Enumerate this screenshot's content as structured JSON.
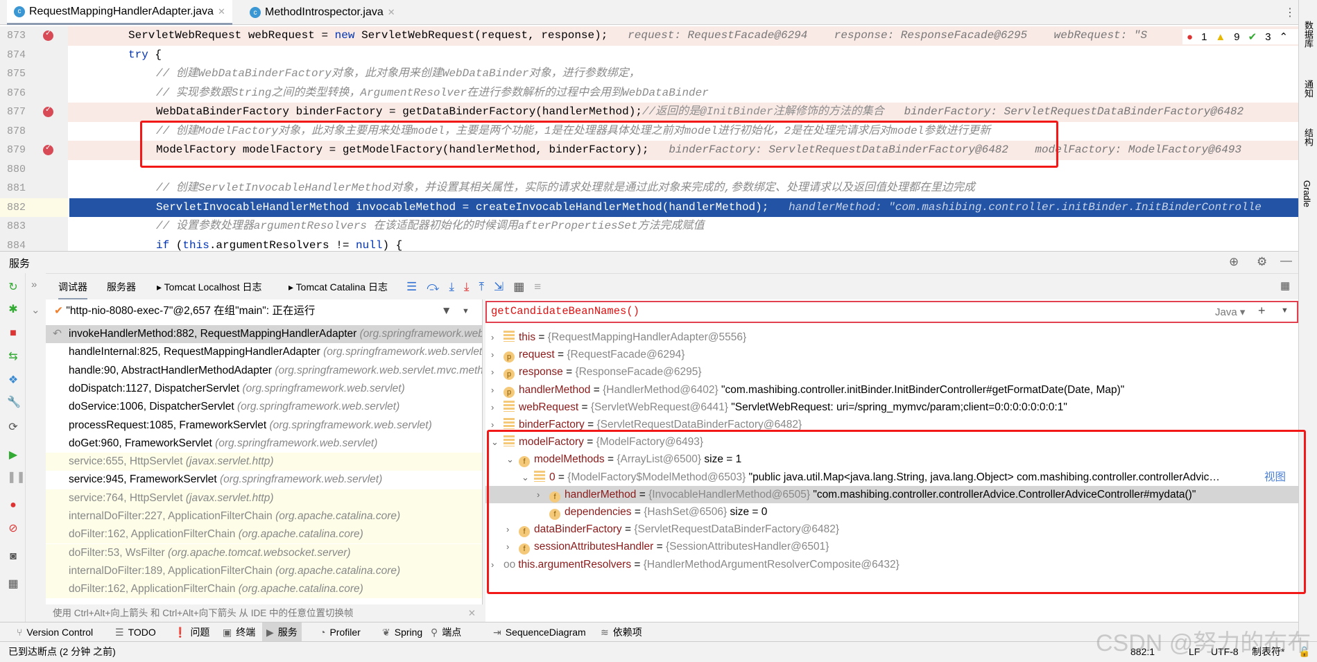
{
  "tabs": [
    {
      "label": "RequestMappingHandlerAdapter.java",
      "active": true
    },
    {
      "label": "MethodIntrospector.java",
      "active": false
    }
  ],
  "inspections": {
    "errors": "1",
    "warnings": "9",
    "ok": "3"
  },
  "editor": {
    "lines": [
      {
        "n": "873",
        "bp": true,
        "pink": true,
        "parts": [
          {
            "c": "ServletWebRequest webRequest = ",
            "k": ""
          },
          {
            "c": "new",
            "k": "kw"
          },
          {
            "c": " ServletWebRequest(request, response);",
            "k": ""
          }
        ],
        "inline": "request: RequestFacade@6294    response: ResponseFacade@6295    webRequest: \"S"
      },
      {
        "n": "874",
        "parts": [
          {
            "c": "try",
            "k": "kw"
          },
          {
            "c": " {",
            "k": ""
          }
        ],
        "indent": 0
      },
      {
        "n": "875",
        "parts": [
          {
            "c": "// 创建WebDataBinderFactory对象，此对象用来创建WebDataBinder对象，进行参数绑定，",
            "k": "cm"
          }
        ],
        "indent": 1
      },
      {
        "n": "876",
        "parts": [
          {
            "c": "// 实现参数跟String之间的类型转换，ArgumentResolver在进行参数解析的过程中会用到WebDataBinder",
            "k": "cm"
          }
        ],
        "indent": 1
      },
      {
        "n": "877",
        "bp": true,
        "pink": true,
        "parts": [
          {
            "c": "WebDataBinderFactory binderFactory = getDataBinderFactory(handlerMethod);",
            "k": ""
          },
          {
            "c": "//返回的是@InitBinder注解修饰的方法的集合",
            "k": "cm"
          }
        ],
        "indent": 1,
        "inline": "binderFactory: ServletRequestDataBinderFactory@6482"
      },
      {
        "n": "878",
        "parts": [
          {
            "c": "// 创建ModelFactory对象，此对象主要用来处理model，主要是两个功能，1是在处理器具体处理之前对model进行初始化，2是在处理完请求后对model参数进行更新",
            "k": "cm"
          }
        ],
        "indent": 1
      },
      {
        "n": "879",
        "bp": true,
        "pink": true,
        "parts": [
          {
            "c": "ModelFactory modelFactory = getModelFactory(handlerMethod, binderFactory);",
            "k": ""
          }
        ],
        "indent": 1,
        "inline": "binderFactory: ServletRequestDataBinderFactory@6482    modelFactory: ModelFactory@6493"
      },
      {
        "n": "880",
        "parts": []
      },
      {
        "n": "881",
        "parts": [
          {
            "c": "// 创建ServletInvocableHandlerMethod对象，并设置其相关属性，实际的请求处理就是通过此对象来完成的,参数绑定、处理请求以及返回值处理都在里边完成",
            "k": "cm"
          }
        ],
        "indent": 1
      },
      {
        "n": "882",
        "sel": true,
        "parts": [
          {
            "c": "ServletInvocableHandlerMethod invocableMethod = createInvocableHandlerMethod(handlerMethod);",
            "k": ""
          }
        ],
        "indent": 1,
        "inline": "handlerMethod: \"com.mashibing.controller.initBinder.InitBinderControlle"
      },
      {
        "n": "883",
        "parts": [
          {
            "c": "// 设置参数处理器argumentResolvers 在该适配器初始化的时候调用afterPropertiesSet方法完成赋值",
            "k": "cm"
          }
        ],
        "indent": 1
      },
      {
        "n": "884",
        "parts": [
          {
            "c": "if",
            "k": "kw"
          },
          {
            "c": " (",
            "k": ""
          },
          {
            "c": "this",
            "k": "kw"
          },
          {
            "c": ".argumentResolvers != ",
            "k": ""
          },
          {
            "c": "null",
            "k": "kw"
          },
          {
            "c": ") {",
            "k": ""
          }
        ],
        "indent": 1
      }
    ]
  },
  "right_tools": [
    "数据库",
    "通知",
    "结构",
    "Gradle"
  ],
  "services": {
    "title": "服务"
  },
  "debug_tabs": [
    "调试器",
    "服务器",
    "Tomcat Localhost 日志",
    "Tomcat Catalina 日志"
  ],
  "thread": "\"http-nio-8080-exec-7\"@2,657 在组\"main\": 正在运行",
  "frames": [
    {
      "m": "invokeHandlerMethod:882, RequestMappingHandlerAdapter",
      "p": "(org.springframework.web.servlet.mvc.method.annotation)",
      "t": "cur"
    },
    {
      "m": "handleInternal:825, RequestMappingHandlerAdapter",
      "p": "(org.springframework.web.servlet.mvc.method.annotation)",
      "t": ""
    },
    {
      "m": "handle:90, AbstractHandlerMethodAdapter",
      "p": "(org.springframework.web.servlet.mvc.method)",
      "t": ""
    },
    {
      "m": "doDispatch:1127, DispatcherServlet",
      "p": "(org.springframework.web.servlet)",
      "t": ""
    },
    {
      "m": "doService:1006, DispatcherServlet",
      "p": "(org.springframework.web.servlet)",
      "t": ""
    },
    {
      "m": "processRequest:1085, FrameworkServlet",
      "p": "(org.springframework.web.servlet)",
      "t": ""
    },
    {
      "m": "doGet:960, FrameworkServlet",
      "p": "(org.springframework.web.servlet)",
      "t": ""
    },
    {
      "m": "service:655, HttpServlet",
      "p": "(javax.servlet.http)",
      "t": "lib"
    },
    {
      "m": "service:945, FrameworkServlet",
      "p": "(org.springframework.web.servlet)",
      "t": ""
    },
    {
      "m": "service:764, HttpServlet",
      "p": "(javax.servlet.http)",
      "t": "lib"
    },
    {
      "m": "internalDoFilter:227, ApplicationFilterChain",
      "p": "(org.apache.catalina.core)",
      "t": "lib"
    },
    {
      "m": "doFilter:162, ApplicationFilterChain",
      "p": "(org.apache.catalina.core)",
      "t": "lib"
    },
    {
      "m": "doFilter:53, WsFilter",
      "p": "(org.apache.tomcat.websocket.server)",
      "t": "lib"
    },
    {
      "m": "internalDoFilter:189, ApplicationFilterChain",
      "p": "(org.apache.catalina.core)",
      "t": "lib"
    },
    {
      "m": "doFilter:162, ApplicationFilterChain",
      "p": "(org.apache.catalina.core)",
      "t": "lib"
    }
  ],
  "hint": "使用 Ctrl+Alt+向上箭头 和 Ctrl+Alt+向下箭头 从 IDE 中的任意位置切换帧",
  "eval": {
    "expression": "getCandidateBeanNames()",
    "lang": "Java"
  },
  "variables": [
    {
      "d": 0,
      "exp": ">",
      "ic": "l",
      "n": "this",
      "t": "{RequestMappingHandlerAdapter@5556}",
      "v": ""
    },
    {
      "d": 0,
      "exp": ">",
      "ic": "p",
      "n": "request",
      "t": "{RequestFacade@6294}",
      "v": ""
    },
    {
      "d": 0,
      "exp": ">",
      "ic": "p",
      "n": "response",
      "t": "{ResponseFacade@6295}",
      "v": ""
    },
    {
      "d": 0,
      "exp": ">",
      "ic": "p",
      "n": "handlerMethod",
      "t": "{HandlerMethod@6402}",
      "v": "\"com.mashibing.controller.initBinder.InitBinderController#getFormatDate(Date, Map)\""
    },
    {
      "d": 0,
      "exp": ">",
      "ic": "l",
      "n": "webRequest",
      "t": "{ServletWebRequest@6441}",
      "v": "\"ServletWebRequest: uri=/spring_mymvc/param;client=0:0:0:0:0:0:0:1\""
    },
    {
      "d": 0,
      "exp": ">",
      "ic": "l",
      "n": "binderFactory",
      "t": "{ServletRequestDataBinderFactory@6482}",
      "v": ""
    },
    {
      "d": 0,
      "exp": "v",
      "ic": "l",
      "n": "modelFactory",
      "t": "{ModelFactory@6493}",
      "v": ""
    },
    {
      "d": 1,
      "exp": "v",
      "ic": "f",
      "n": "modelMethods",
      "t": "{ArrayList@6500}",
      "v": "size = 1"
    },
    {
      "d": 2,
      "exp": "v",
      "ic": "l",
      "n": "0",
      "t": "{ModelFactory$ModelMethod@6503}",
      "v": "\"public java.util.Map<java.lang.String, java.lang.Object> com.mashibing.controller.controllerAdvic…",
      "link": "视图"
    },
    {
      "d": 3,
      "exp": ">",
      "ic": "f",
      "n": "handlerMethod",
      "t": "{InvocableHandlerMethod@6505}",
      "v": "\"com.mashibing.controller.controllerAdvice.ControllerAdviceController#mydata()\"",
      "sel": true
    },
    {
      "d": 3,
      "exp": "",
      "ic": "f",
      "n": "dependencies",
      "t": "{HashSet@6506}",
      "v": "size = 0"
    },
    {
      "d": 1,
      "exp": ">",
      "ic": "f",
      "n": "dataBinderFactory",
      "t": "{ServletRequestDataBinderFactory@6482}",
      "v": ""
    },
    {
      "d": 1,
      "exp": ">",
      "ic": "f",
      "n": "sessionAttributesHandler",
      "t": "{SessionAttributesHandler@6501}",
      "v": ""
    },
    {
      "d": 0,
      "exp": ">",
      "ic": "w",
      "n": "this.argumentResolvers",
      "t": "{HandlerMethodArgumentResolverComposite@6432}",
      "v": ""
    }
  ],
  "bottom_tools": [
    {
      "label": "Version Control",
      "icon": "⑂"
    },
    {
      "label": "TODO",
      "icon": "☰"
    },
    {
      "label": "问题",
      "icon": "❗"
    },
    {
      "label": "终端",
      "icon": "▣"
    },
    {
      "label": "服务",
      "icon": "▶",
      "active": true
    },
    {
      "label": "Profiler",
      "icon": "◔"
    },
    {
      "label": "Spring",
      "icon": "❦"
    },
    {
      "label": "端点",
      "icon": "⚲"
    },
    {
      "label": "SequenceDiagram",
      "icon": "⇥"
    },
    {
      "label": "依赖项",
      "icon": "≋"
    }
  ],
  "status": {
    "message": "已到达断点 (2 分钟 之前)",
    "position": "882:1",
    "line_sep": "LF",
    "encoding": "UTF-8",
    "indent": "制表符*"
  },
  "watermark": "CSDN @努力的布布",
  "colors": {
    "selection": "#2253a4",
    "highlight_box": "#f21818",
    "breakpoint": "#d84a55"
  }
}
